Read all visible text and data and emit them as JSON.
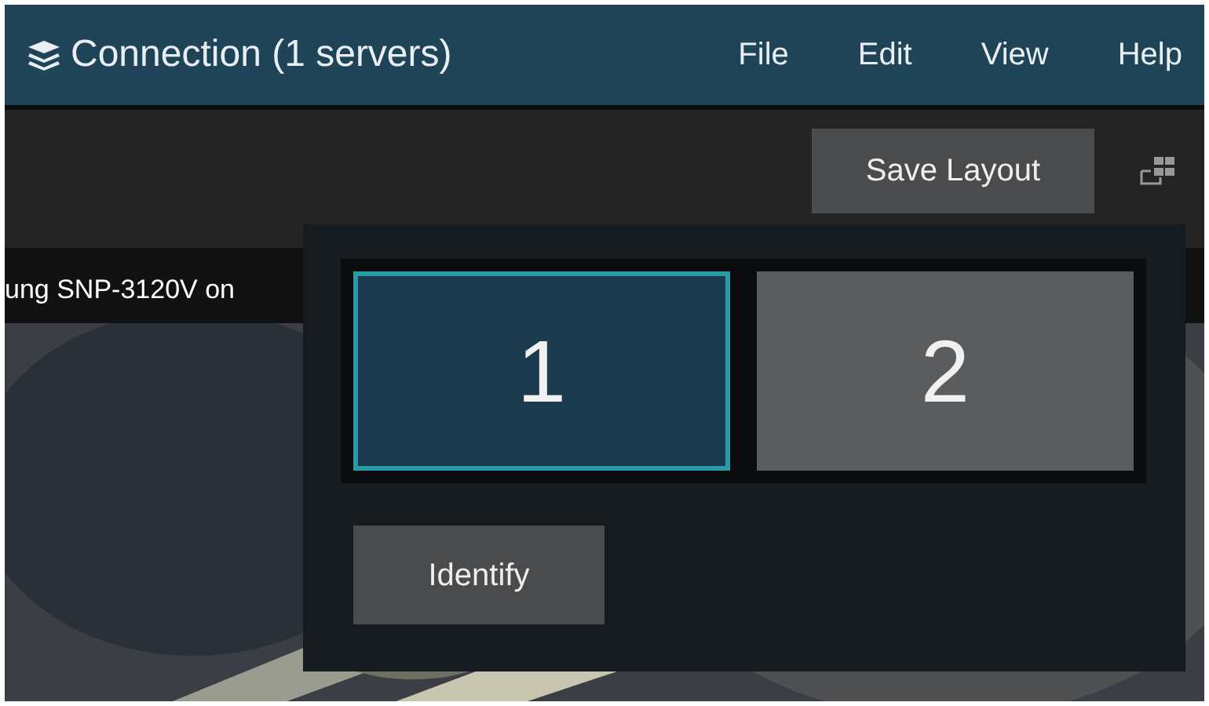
{
  "window": {
    "title": "Connection (1 servers)"
  },
  "menu": [
    {
      "label": "File"
    },
    {
      "label": "Edit"
    },
    {
      "label": "View"
    },
    {
      "label": "Help"
    }
  ],
  "toolbar": {
    "save_button": "Save Layout"
  },
  "video": {
    "caption": "ung SNP-3120V on"
  },
  "monitor_popup": {
    "monitors": [
      {
        "label": "1",
        "selected": true
      },
      {
        "label": "2",
        "selected": false
      }
    ],
    "identify_button": "Identify"
  }
}
